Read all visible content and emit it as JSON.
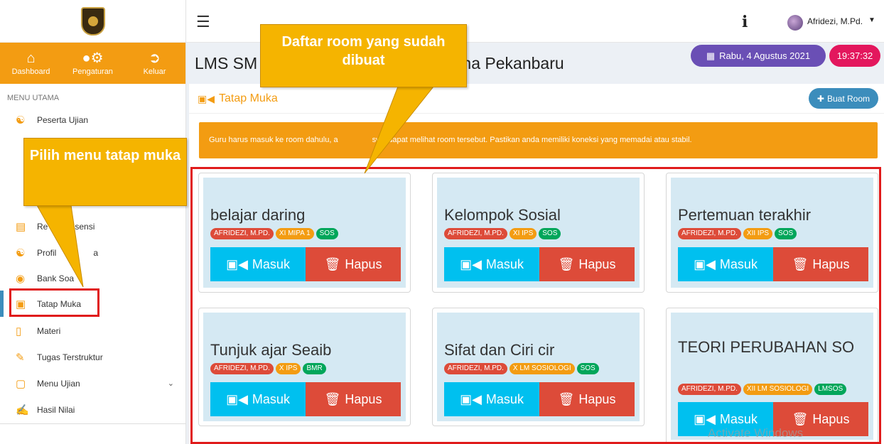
{
  "sidebar": {
    "quick_nav": [
      {
        "label": "Dashboard",
        "icon": "home-icon"
      },
      {
        "label": "Pengaturan",
        "icon": "user-gear-icon"
      },
      {
        "label": "Keluar",
        "icon": "sign-out-icon"
      }
    ],
    "menu_header": "MENU UTAMA",
    "items": [
      {
        "label": "Peserta Ujian",
        "icon": "users-icon"
      },
      {
        "label": "Re",
        "label_tail": "sensi",
        "icon": "calendar-icon"
      },
      {
        "label": "Profil",
        "label_tail": "a",
        "icon": "people-icon"
      },
      {
        "label": "Bank Soa",
        "icon": "database-icon"
      },
      {
        "label": "Tatap Muka",
        "icon": "video-icon"
      },
      {
        "label": "Materi",
        "icon": "file-icon"
      },
      {
        "label": "Tugas Terstruktur",
        "icon": "edit-icon"
      },
      {
        "label": "Menu Ujian",
        "icon": "monitor-icon"
      },
      {
        "label": "Hasil Nilai",
        "icon": "signature-icon"
      }
    ]
  },
  "topbar": {
    "user_name": "Afridezi, M.Pd."
  },
  "header": {
    "title_left": "LMS SM",
    "title_right": "A Cendana Pekanbaru",
    "date": "Rabu, 4 Agustus 2021",
    "time": "19:37:32"
  },
  "panel": {
    "title": "Tatap Muka",
    "buat_room_label": "Buat Room",
    "notice_part1": "Guru harus masuk ke room dahulu, a",
    "notice_part2": "swa dapat melihat room tersebut. Pastikan anda memiliki koneksi yang memadai atau stabil."
  },
  "rooms": [
    {
      "title": "belajar daring",
      "badges": [
        "AFRIDEZI, M.PD.",
        "XI MIPA 1",
        "SOS"
      ]
    },
    {
      "title": "Kelompok Sosial",
      "badges": [
        "AFRIDEZI, M.PD.",
        "XI IPS",
        "SOS"
      ]
    },
    {
      "title": "Pertemuan terakhir",
      "badges": [
        "AFRIDEZI, M.PD.",
        "XII IPS",
        "SOS"
      ]
    },
    {
      "title": "Tunjuk ajar Seaib",
      "badges": [
        "AFRIDEZI, M.PD.",
        "X IPS",
        "BMR"
      ]
    },
    {
      "title": "Sifat dan Ciri cir",
      "badges": [
        "AFRIDEZI, M.PD.",
        "X LM SOSIOLOGI",
        "SOS"
      ]
    },
    {
      "title": "TEORI PERUBAHAN SO",
      "badges": [
        "AFRIDEZI, M.PD.",
        "XII LM SOSIOLOGI",
        "LMSOS"
      ]
    }
  ],
  "room_buttons": {
    "masuk": "Masuk",
    "hapus": "Hapus"
  },
  "callouts": {
    "daftar": "Daftar  room yang sudah dibuat",
    "pilih": "Pilih menu tatap muka"
  },
  "watermark": "Activate Windows",
  "colors": {
    "accent": "#f39c12",
    "primary": "#3c8dbc",
    "masuk": "#00c0ef",
    "hapus": "#dd4b39",
    "highlight": "#e01b1b"
  }
}
